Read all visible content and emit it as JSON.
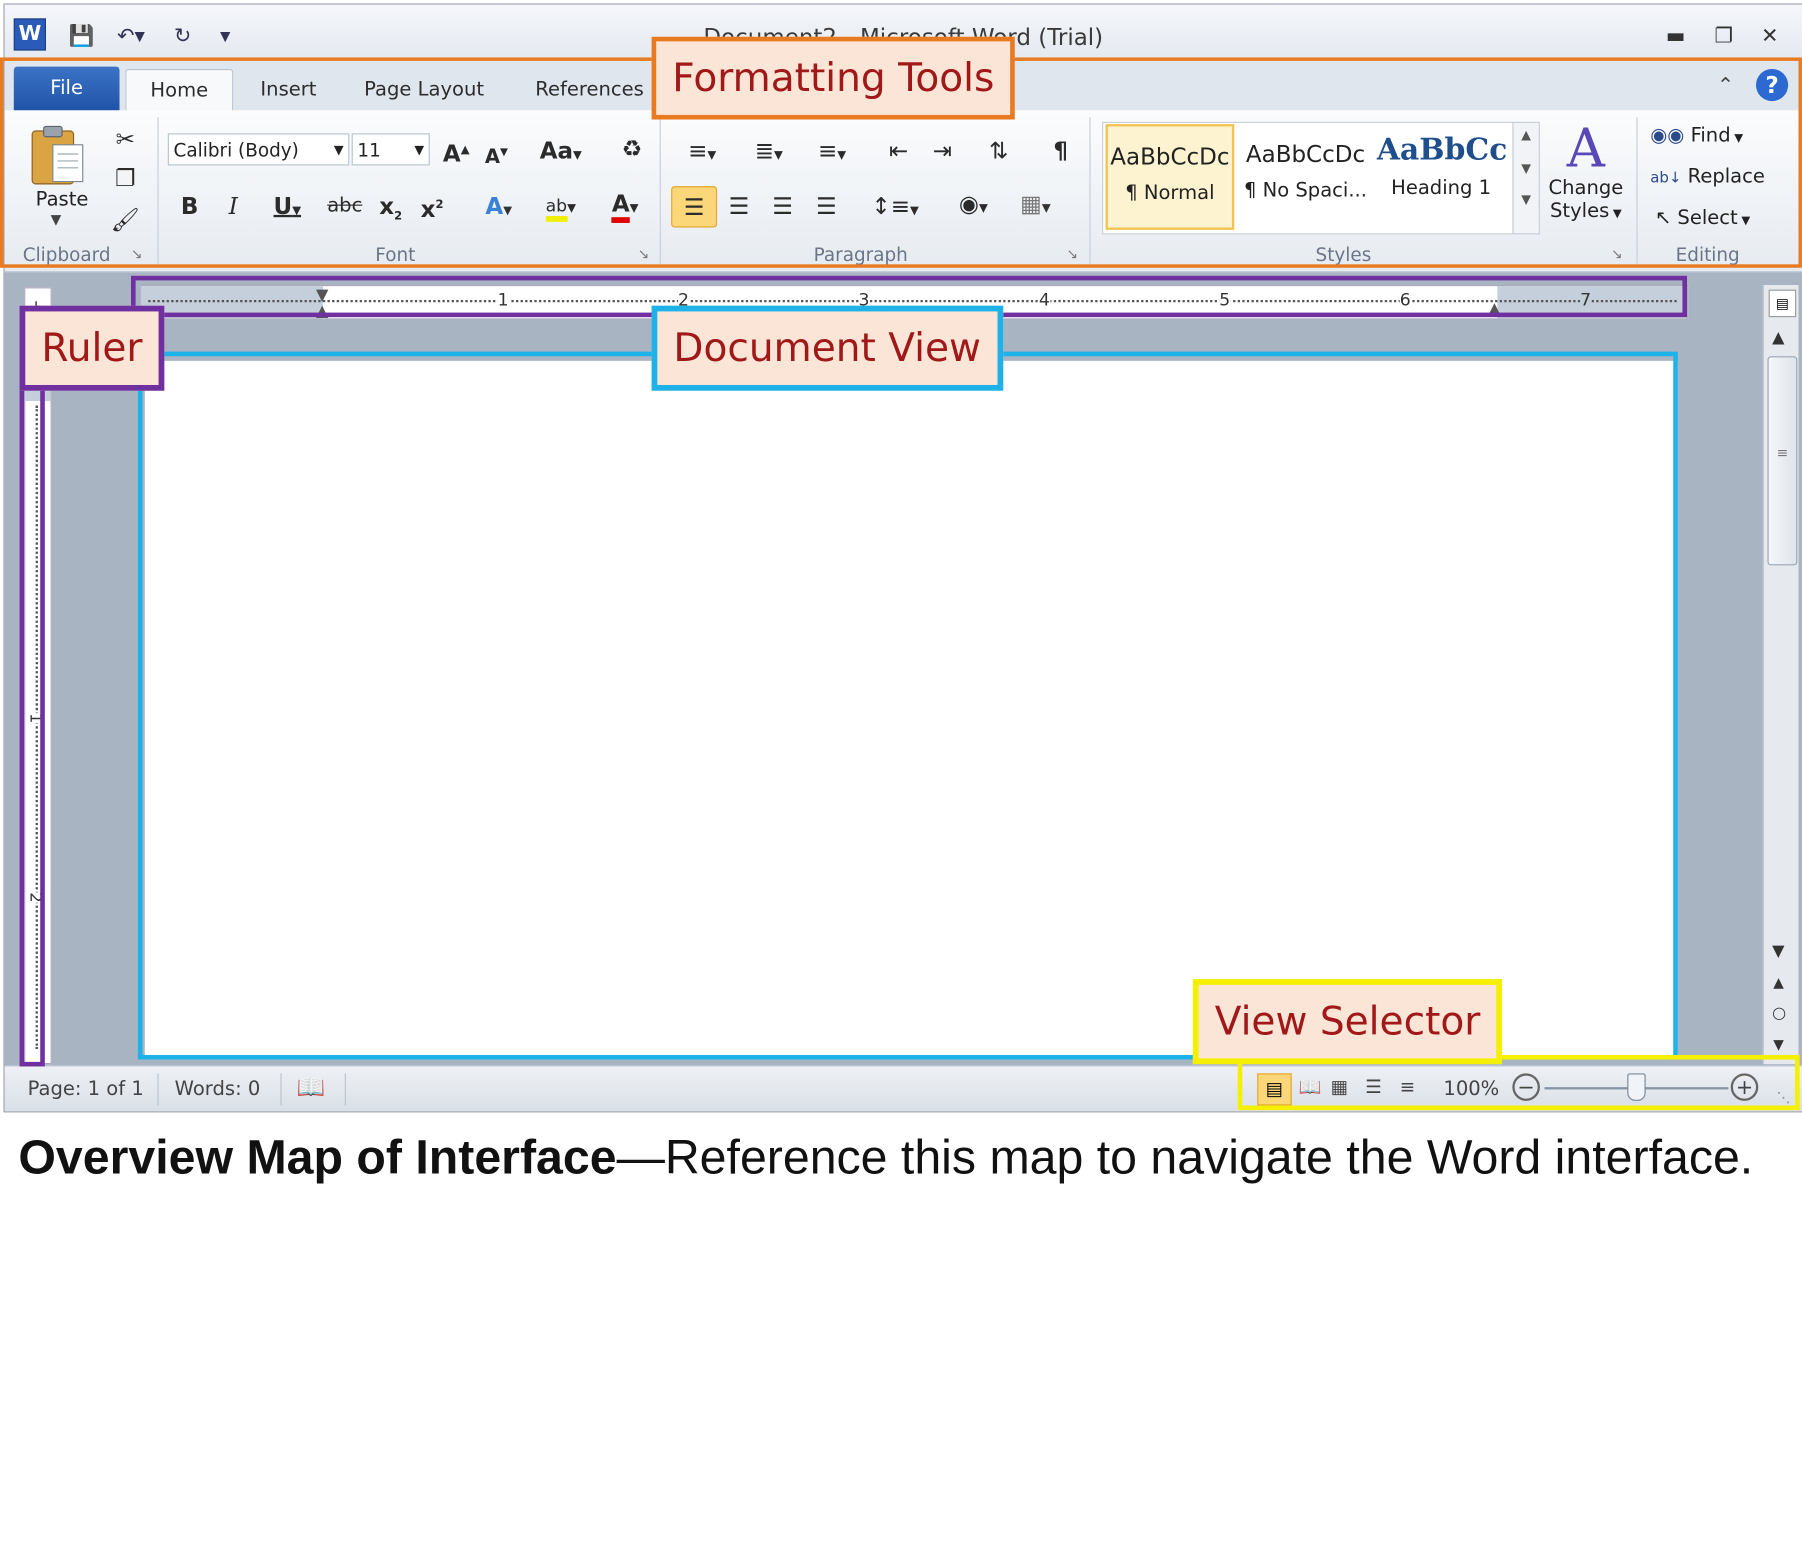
{
  "window": {
    "title": "Document2 - Microsoft Word (Trial)"
  },
  "qat": {
    "save_icon": "save-icon",
    "undo_icon": "undo-icon",
    "redo_icon": "redo-icon",
    "customize_icon": "customize-qat-icon"
  },
  "tabs": [
    "File",
    "Home",
    "Insert",
    "Page Layout",
    "References"
  ],
  "clipboard": {
    "paste_label": "Paste",
    "group_label": "Clipboard"
  },
  "font": {
    "name": "Calibri (Body)",
    "size": "11",
    "change_case": "Aa",
    "group_label": "Font"
  },
  "paragraph": {
    "group_label": "Paragraph"
  },
  "styles": {
    "items": [
      {
        "sample": "AaBbCcDc",
        "name": "¶ Normal"
      },
      {
        "sample": "AaBbCcDc",
        "name": "¶ No Spaci..."
      },
      {
        "sample": "AaBbCc",
        "name": "Heading 1"
      }
    ],
    "change_styles_line1": "Change",
    "change_styles_line2": "Styles",
    "group_label": "Styles"
  },
  "editing": {
    "find": "Find",
    "replace": "Replace",
    "select": "Select",
    "group_label": "Editing"
  },
  "ruler": {
    "numbers": [
      "1",
      "2",
      "3",
      "4",
      "5",
      "6",
      "7"
    ]
  },
  "status": {
    "page": "Page: 1 of 1",
    "words": "Words: 0",
    "zoom": "100%"
  },
  "callouts": {
    "formatting_tools": "Formatting Tools",
    "ruler": "Ruler",
    "document_view": "Document View",
    "view_selector": "View Selector"
  },
  "caption": {
    "bold": "Overview Map of Interface",
    "rest": "—Reference this map to navigate the Word interface."
  },
  "colors": {
    "orange": "#e87a22",
    "purple": "#7030a0",
    "cyan": "#1fb2e8",
    "yellow": "#f5f000",
    "callout_text": "#a01818",
    "callout_bg": "#fbe5d6"
  }
}
